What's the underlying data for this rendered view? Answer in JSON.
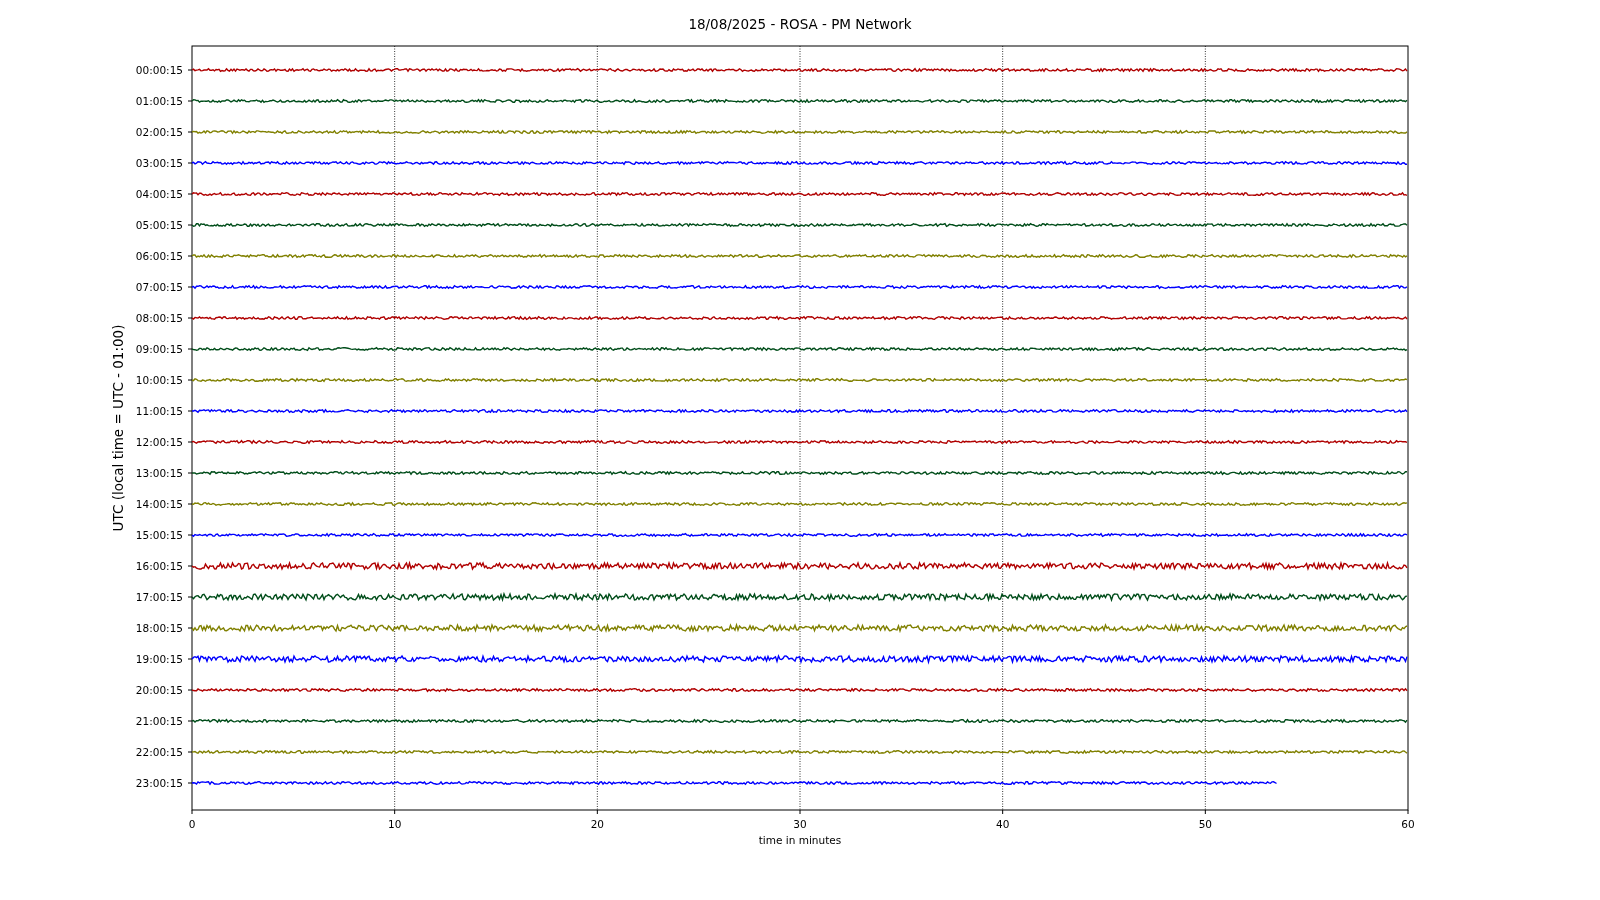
{
  "title": "18/08/2025 - ROSA - PM Network",
  "ylabel": "UTC (local time = UTC - 01:00)",
  "xlabel": "time in minutes",
  "xticks": [
    "0",
    "10",
    "20",
    "30",
    "40",
    "50",
    "60"
  ],
  "traces": [
    {
      "label": "00:00:15",
      "color": "#b00000",
      "level": 1
    },
    {
      "label": "01:00:15",
      "color": "#004d1a",
      "level": 1
    },
    {
      "label": "02:00:15",
      "color": "#808000",
      "level": 1
    },
    {
      "label": "03:00:15",
      "color": "#0000ff",
      "level": 1
    },
    {
      "label": "04:00:15",
      "color": "#b00000",
      "level": 1
    },
    {
      "label": "05:00:15",
      "color": "#004d1a",
      "level": 1
    },
    {
      "label": "06:00:15",
      "color": "#808000",
      "level": 1
    },
    {
      "label": "07:00:15",
      "color": "#0000ff",
      "level": 1
    },
    {
      "label": "08:00:15",
      "color": "#b00000",
      "level": 1
    },
    {
      "label": "09:00:15",
      "color": "#004d1a",
      "level": 1
    },
    {
      "label": "10:00:15",
      "color": "#808000",
      "level": 1
    },
    {
      "label": "11:00:15",
      "color": "#0000ff",
      "level": 1
    },
    {
      "label": "12:00:15",
      "color": "#b00000",
      "level": 1
    },
    {
      "label": "13:00:15",
      "color": "#004d1a",
      "level": 1
    },
    {
      "label": "14:00:15",
      "color": "#808000",
      "level": 1
    },
    {
      "label": "15:00:15",
      "color": "#0000ff",
      "level": 1
    },
    {
      "label": "16:00:15",
      "color": "#b00000",
      "level": 1
    },
    {
      "label": "17:00:15",
      "color": "#004d1a",
      "level": 1
    },
    {
      "label": "18:00:15",
      "color": "#808000",
      "level": 1
    },
    {
      "label": "19:00:15",
      "color": "#0000ff",
      "level": 1
    },
    {
      "label": "20:00:15",
      "color": "#b00000",
      "level": 1
    },
    {
      "label": "21:00:15",
      "color": "#004d1a",
      "level": 1
    },
    {
      "label": "22:00:15",
      "color": "#808000",
      "level": 1
    },
    {
      "label": "23:00:15",
      "color": "#0000ff",
      "level": 0.892
    }
  ]
}
